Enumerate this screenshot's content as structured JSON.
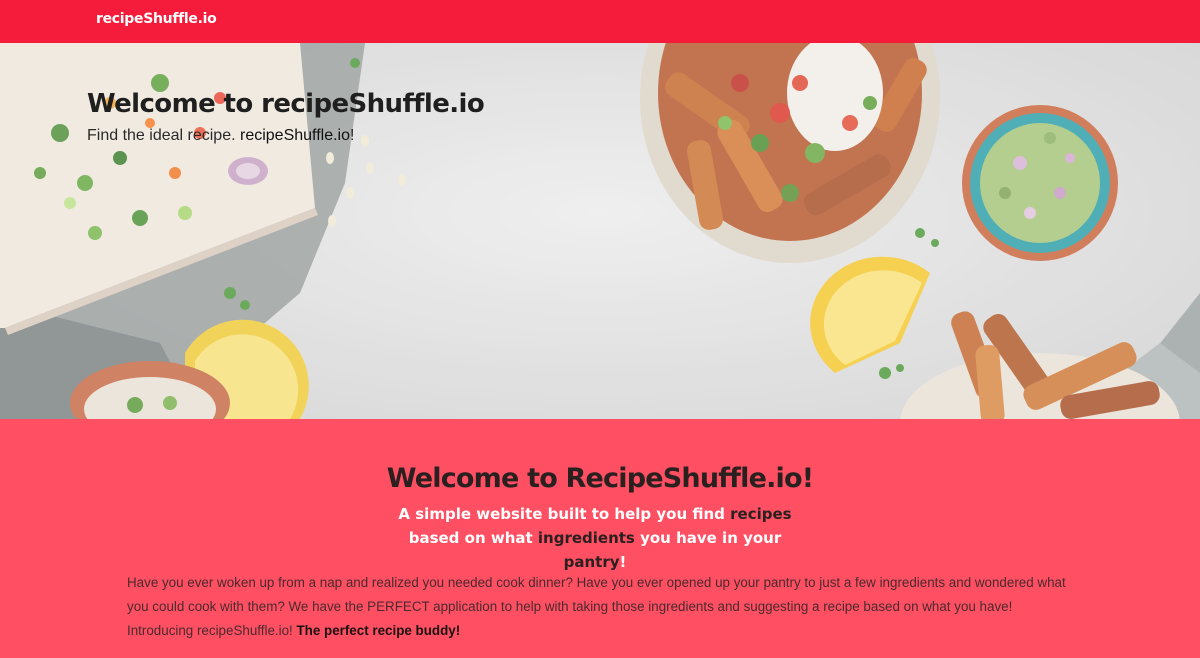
{
  "navbar": {
    "brand": "recipeShuffle.io"
  },
  "hero": {
    "title": "Welcome to recipeShuffle.io",
    "subtitle_prefix": "Find the ideal recipe. ",
    "subtitle_brand": "recipeShuffle.io",
    "subtitle_suffix": "!"
  },
  "intro": {
    "title": "Welcome to RecipeShuffle.io!",
    "tagline": {
      "part1": "A simple website built to help you find ",
      "hl1": "recipes",
      "part2": " based on what ",
      "hl2": "ingredients",
      "part3": " you have in your ",
      "hl3": "pantry",
      "part4": "!"
    },
    "body": "Have you ever woken up from a nap and realized you needed cook dinner? Have you ever opened up your pantry to just a few ingredients and wondered what you could cook with them? We have the PERFECT application to help with taking those ingredients and suggesting a recipe based on what you have! Introducing recipeShuffle.io! ",
    "body_strong": "The perfect recipe buddy!"
  },
  "colors": {
    "navbar": "#f41c3a",
    "section": "#ff4f63",
    "hero_bg": "#e3e3e3"
  }
}
